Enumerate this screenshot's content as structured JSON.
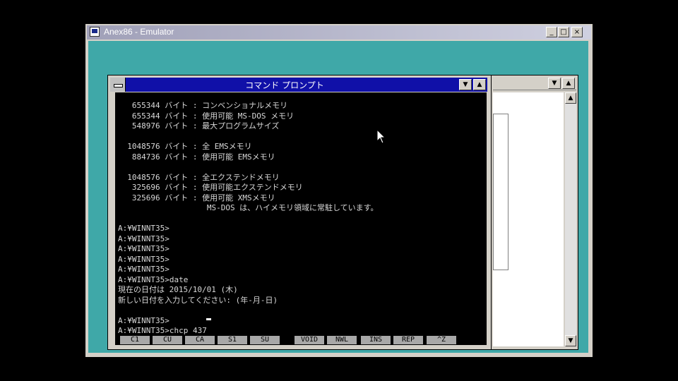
{
  "window": {
    "title": "Anex86 - Emulator",
    "buttons": {
      "minimize": "_",
      "maximize": "□",
      "close": "×"
    }
  },
  "command_prompt": {
    "title": "コマンド プロンプト",
    "scroll_down": "▼",
    "scroll_up": "▲",
    "lines": [
      "   655344 バイト : コンベンショナルメモリ",
      "   655344 バイト : 使用可能 MS-DOS メモリ",
      "   548976 バイト : 最大プログラムサイズ",
      "",
      "  1048576 バイト : 全 EMSメモリ",
      "   884736 バイト : 使用可能 EMSメモリ",
      "",
      "  1048576 バイト : 全エクステンドメモリ",
      "   325696 バイト : 使用可能エクステンドメモリ",
      "   325696 バイト : 使用可能 XMSメモリ",
      "                   MS-DOS は、ハイメモリ領域に常駐しています。",
      "",
      "A:¥WINNT35>",
      "A:¥WINNT35>",
      "A:¥WINNT35>",
      "A:¥WINNT35>",
      "A:¥WINNT35>",
      "A:¥WINNT35>date",
      "現在の日付は 2015/10/01 (木)",
      "新しい日付を入力してください: (年-月-日)",
      "",
      "A:¥WINNT35>",
      "A:¥WINNT35>chcp 437"
    ],
    "function_keys": [
      "C1",
      "CU",
      "CA",
      "S1",
      "SU",
      "VOID",
      "NWL",
      "INS",
      "REP",
      "^Z"
    ]
  },
  "background_window": {
    "scroll_down": "▼",
    "scroll_up": "▲"
  }
}
